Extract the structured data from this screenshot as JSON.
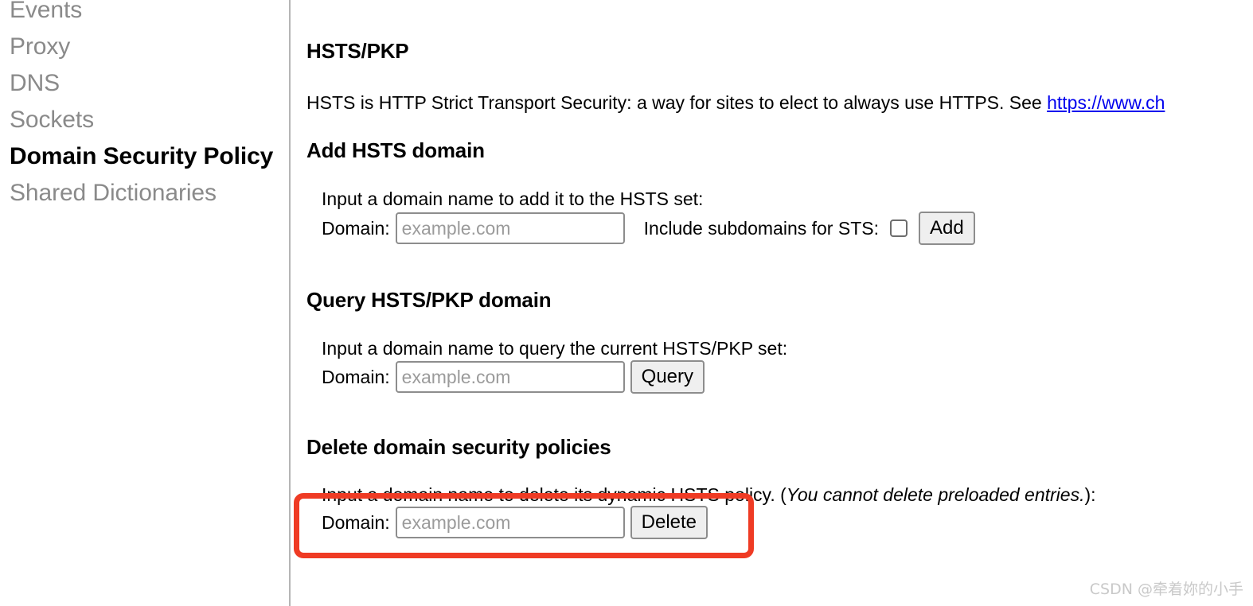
{
  "sidebar": {
    "items": [
      {
        "label": "Events",
        "selected": false
      },
      {
        "label": "Proxy",
        "selected": false
      },
      {
        "label": "DNS",
        "selected": false
      },
      {
        "label": "Sockets",
        "selected": false
      },
      {
        "label": "Domain Security Policy",
        "selected": true
      },
      {
        "label": "Shared Dictionaries",
        "selected": false
      }
    ]
  },
  "main": {
    "page_title": "HSTS/PKP",
    "intro": {
      "text_before_link": "HSTS is HTTP Strict Transport Security: a way for sites to elect to always use HTTPS. See ",
      "link_text": "https://www.ch"
    },
    "add_section": {
      "heading": "Add HSTS domain",
      "description": "Input a domain name to add it to the HSTS set:",
      "domain_label": "Domain:",
      "domain_value": "",
      "domain_placeholder": "example.com",
      "subdomains_label": "Include subdomains for STS:",
      "subdomains_checked": false,
      "button_label": "Add"
    },
    "query_section": {
      "heading": "Query HSTS/PKP domain",
      "description": "Input a domain name to query the current HSTS/PKP set:",
      "domain_label": "Domain:",
      "domain_value": "",
      "domain_placeholder": "example.com",
      "button_label": "Query"
    },
    "delete_section": {
      "heading": "Delete domain security policies",
      "description_before": "Input a domain name to delete its dynamic HSTS policy. (",
      "description_italic": "You cannot delete preloaded entries.",
      "description_after": "):",
      "domain_label": "Domain:",
      "domain_value": "",
      "domain_placeholder": "example.com",
      "button_label": "Delete"
    }
  },
  "annotation": {
    "color": "#ef3b24"
  },
  "watermark": {
    "text": "CSDN @牵着妳的小手"
  }
}
